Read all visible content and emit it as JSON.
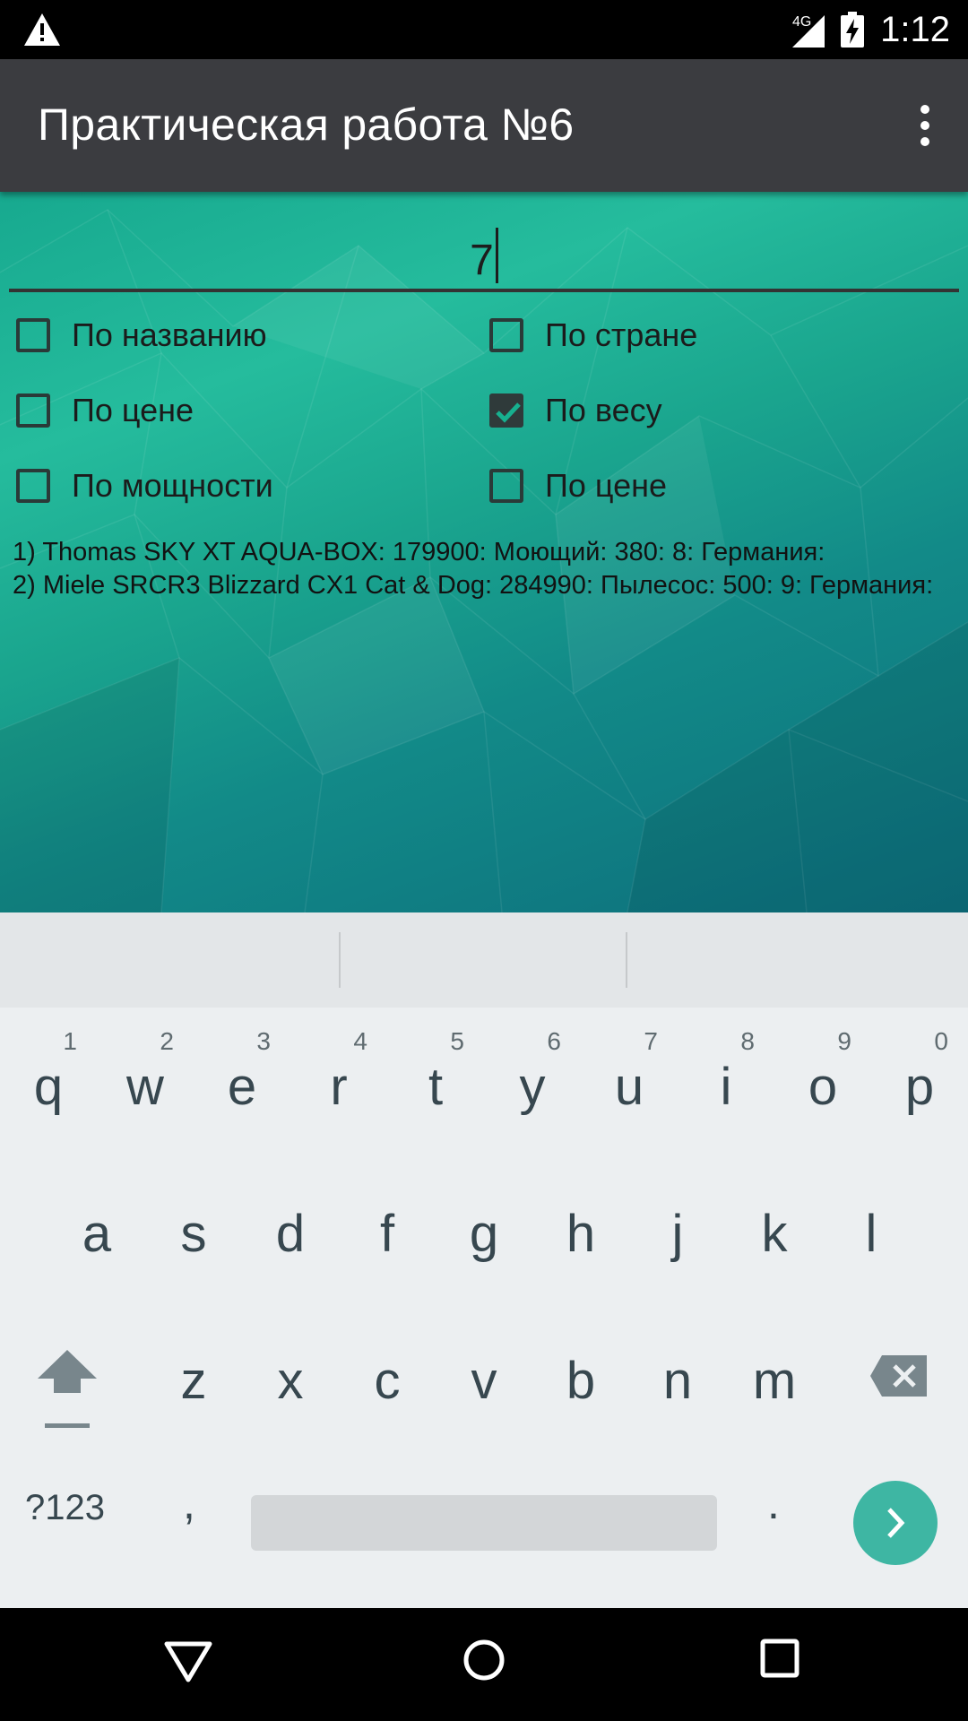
{
  "status": {
    "network": "4G",
    "time": "1:12"
  },
  "appbar": {
    "title": "Практическая работа №6"
  },
  "input": {
    "value": "7"
  },
  "checkboxes": [
    {
      "label": "По названию",
      "checked": false
    },
    {
      "label": "По стране",
      "checked": false
    },
    {
      "label": "По цене",
      "checked": false
    },
    {
      "label": "По весу",
      "checked": true
    },
    {
      "label": "По мощности",
      "checked": false
    },
    {
      "label": "По цене",
      "checked": false
    }
  ],
  "results": [
    "1) Thomas SKY XT AQUA-BOX: 179900: Моющий: 380: 8: Германия:",
    "2) Miele SRCR3 Blizzard CX1 Cat & Dog: 284990: Пылесос: 500: 9: Германия:"
  ],
  "keyboard": {
    "row1": [
      {
        "k": "q",
        "h": "1"
      },
      {
        "k": "w",
        "h": "2"
      },
      {
        "k": "e",
        "h": "3"
      },
      {
        "k": "r",
        "h": "4"
      },
      {
        "k": "t",
        "h": "5"
      },
      {
        "k": "y",
        "h": "6"
      },
      {
        "k": "u",
        "h": "7"
      },
      {
        "k": "i",
        "h": "8"
      },
      {
        "k": "o",
        "h": "9"
      },
      {
        "k": "p",
        "h": "0"
      }
    ],
    "row2": [
      "a",
      "s",
      "d",
      "f",
      "g",
      "h",
      "j",
      "k",
      "l"
    ],
    "row3": [
      "z",
      "x",
      "c",
      "v",
      "b",
      "n",
      "m"
    ],
    "symbols_label": "?123",
    "comma": ",",
    "period": ".",
    "accent_color": "#3eb6a3"
  },
  "icons": [
    "warning-icon",
    "signal-icon",
    "battery-charging-icon",
    "overflow-menu-icon",
    "shift-icon",
    "backspace-icon",
    "go-arrow-icon",
    "nav-back-icon",
    "nav-home-icon",
    "nav-recents-icon"
  ]
}
